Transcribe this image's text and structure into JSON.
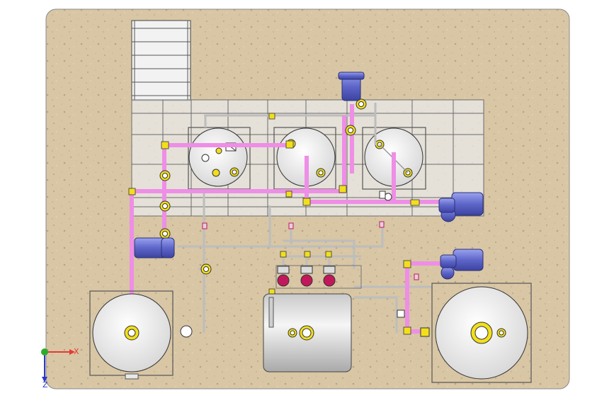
{
  "view": {
    "axis_x_label": "X",
    "axis_y_label": "Y",
    "axis_z_label": "Z"
  },
  "colors": {
    "background": "#ffffff",
    "ground": "#d9c6a6",
    "pipe_pink": "#ef8ee8",
    "pipe_yellow": "#f2df1c",
    "pump_blue": "#6f78d8",
    "tank_fill": "#f4f4f4",
    "frame_line": "#6a6a6a",
    "valve_red": "#c2185b",
    "axis_red": "#e53935",
    "axis_green": "#2eaa2e",
    "axis_blue": "#2d39c8"
  }
}
